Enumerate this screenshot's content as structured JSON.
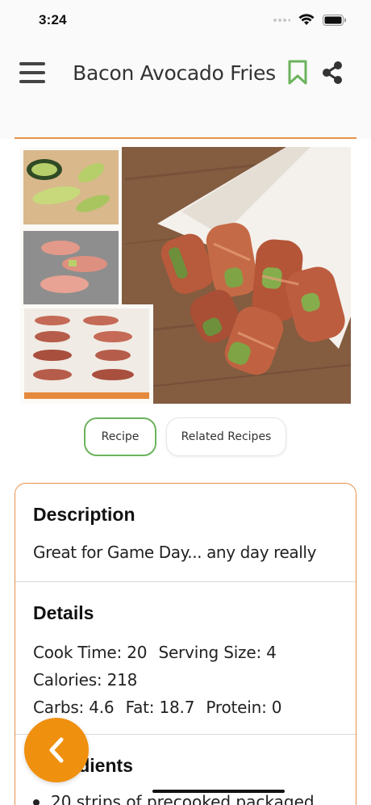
{
  "status_bar": {
    "time": "3:24",
    "icons": [
      "signal-icon",
      "wifi-icon",
      "battery-icon"
    ]
  },
  "header": {
    "title": "Bacon Avocado Fries",
    "menu_icon": "hamburger-menu-icon",
    "bookmark_icon": "bookmark-icon",
    "share_icon": "share-icon"
  },
  "colors": {
    "accent_orange": "#e6924a",
    "fab_orange": "#f0900f",
    "accent_green": "#6bb35c"
  },
  "tabs": [
    {
      "label": "Recipe",
      "active": true
    },
    {
      "label": "Related Recipes",
      "active": false
    }
  ],
  "description": {
    "heading": "Description",
    "text": "Great for Game Day... any day really"
  },
  "details": {
    "heading": "Details",
    "cook_time": "Cook Time: 20",
    "serving_size": "Serving Size: 4",
    "calories": "Calories: 218",
    "carbs": "Carbs: 4.6",
    "fat": "Fat: 18.7",
    "protein": "Protein: 0"
  },
  "ingredients": {
    "heading": "Ingredients",
    "items": [
      "20 strips of precooked packaged"
    ]
  },
  "fab": {
    "icon": "chevron-left-icon"
  }
}
